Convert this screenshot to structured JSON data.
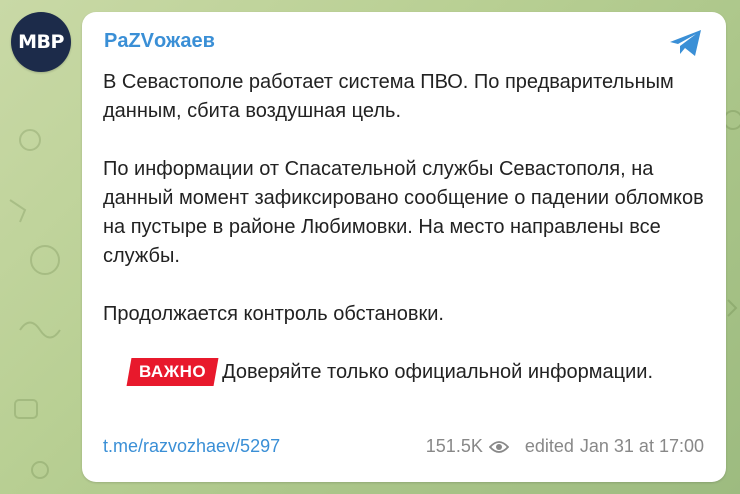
{
  "channel": {
    "avatar_text": "MBP",
    "name": "PaZVожаев"
  },
  "message": {
    "paragraphs": [
      "В Севастополе работает система ПВО. По предварительным данным, сбита воздушная цель.",
      "По информации от Спасательной службы Севастополя, на данный момент зафиксировано сообщение о падении обломков на пустыре в районе Любимовки. На место направлены все службы.",
      "Продолжается контроль обстановки."
    ],
    "badge": "ВАЖНО",
    "badge_text": "Доверяйте только официальной информации."
  },
  "footer": {
    "link": "t.me/razvozhaev/5297",
    "views": "151.5K",
    "edited": "edited",
    "datetime": "Jan 31 at 17:00"
  },
  "colors": {
    "accent": "#3a8fd6",
    "badge": "#e8192c",
    "avatar_bg": "#1c2b4a"
  },
  "icons": {
    "share": "telegram-send-icon",
    "views": "eye-icon"
  }
}
